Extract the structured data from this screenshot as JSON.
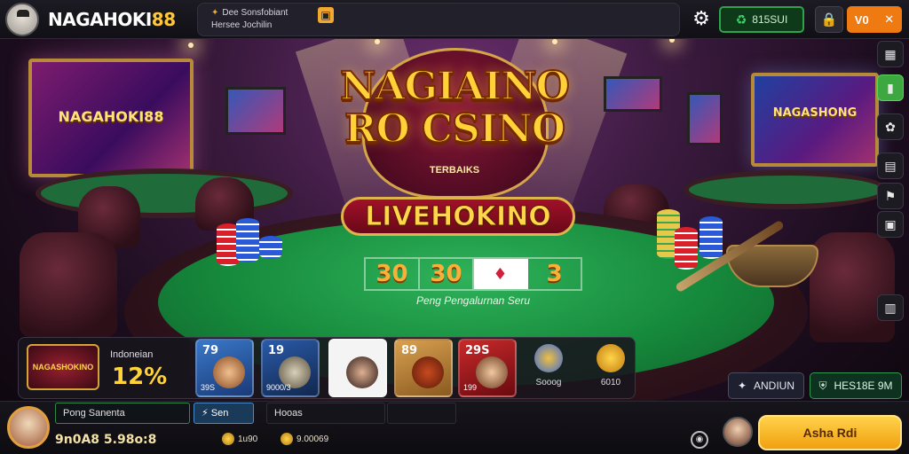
{
  "header": {
    "brand_white": "NAGAHOKI",
    "brand_yellow": "88",
    "notice_line1": "Dee Sonsfobiant",
    "notice_line2": "Hersee Jochilin",
    "btn_green_label": "815SUI",
    "btn_orange_label": "V0"
  },
  "scene": {
    "left_screen_text": "NAGAHOKI88",
    "right_screen_text": "NAGASHONG",
    "title_line1": "NAGIAINO",
    "title_line2": "RO CSINO",
    "title_sub": "TERBAIKS",
    "live_label": "LIVEHOKINO",
    "bet_values": [
      "30",
      "30",
      "3"
    ],
    "felt_text": "Peng Pengalurnan Seru"
  },
  "promo": {
    "logo_text": "NAGASHOKINO",
    "label": "Indoneian",
    "value": "12%"
  },
  "tiles": [
    {
      "num": "79",
      "cap": "39S"
    },
    {
      "num": "19",
      "cap": "9000/3"
    },
    {
      "num": "",
      "cap": ""
    },
    {
      "num": "89",
      "cap": ""
    },
    {
      "num": "29S",
      "cap": "199"
    }
  ],
  "icon_items": [
    {
      "label": "Sooog"
    },
    {
      "label": "6010"
    }
  ],
  "actions": {
    "dark_label": "ANDIUN",
    "green_label": "HES18E 9M"
  },
  "footer": {
    "field1": "Pong Sanenta",
    "field2": "Sen",
    "field3": "Hooas",
    "balance": "9n0A8 5.98o:8",
    "coin1": "1u90",
    "coin2": "9.00069",
    "cta_label": "Asha Rdi"
  }
}
